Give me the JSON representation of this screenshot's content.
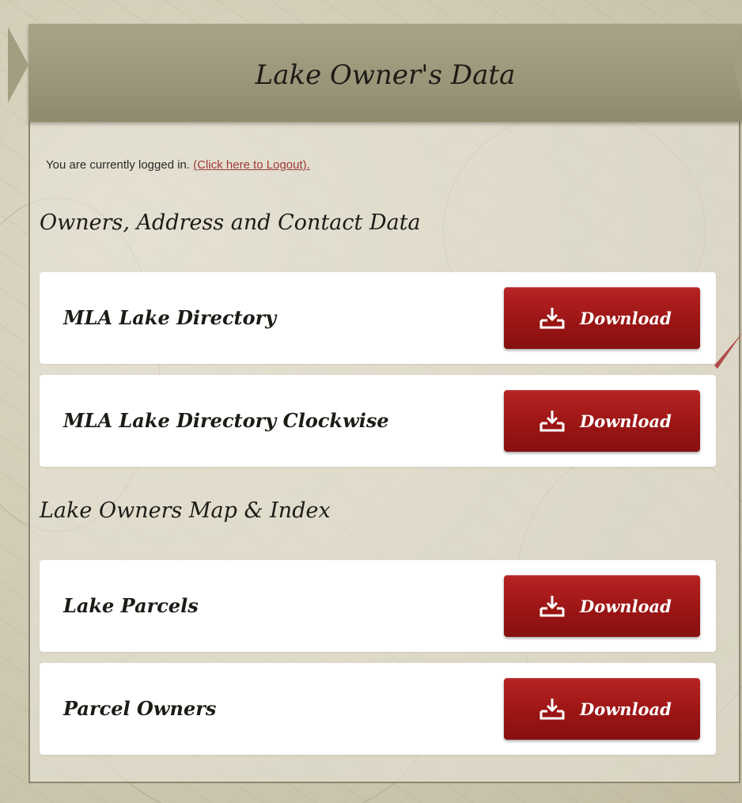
{
  "header": {
    "title": "Lake Owner's Data"
  },
  "login": {
    "status_text": "You are currently logged in. ",
    "logout_link": "(Click here to Logout)."
  },
  "sections": [
    {
      "heading": "Owners, Address and Contact Data",
      "items": [
        {
          "label": "MLA Lake Directory",
          "button": "Download"
        },
        {
          "label": "MLA Lake Directory Clockwise",
          "button": "Download"
        }
      ]
    },
    {
      "heading": "Lake Owners Map & Index",
      "items": [
        {
          "label": "Lake Parcels",
          "button": "Download"
        },
        {
          "label": "Parcel Owners",
          "button": "Download"
        }
      ]
    }
  ],
  "icons": {
    "download": "download-icon"
  },
  "colors": {
    "button_red": "#9c1515",
    "header_band": "#9b9579",
    "link_red": "#a03a3a"
  }
}
